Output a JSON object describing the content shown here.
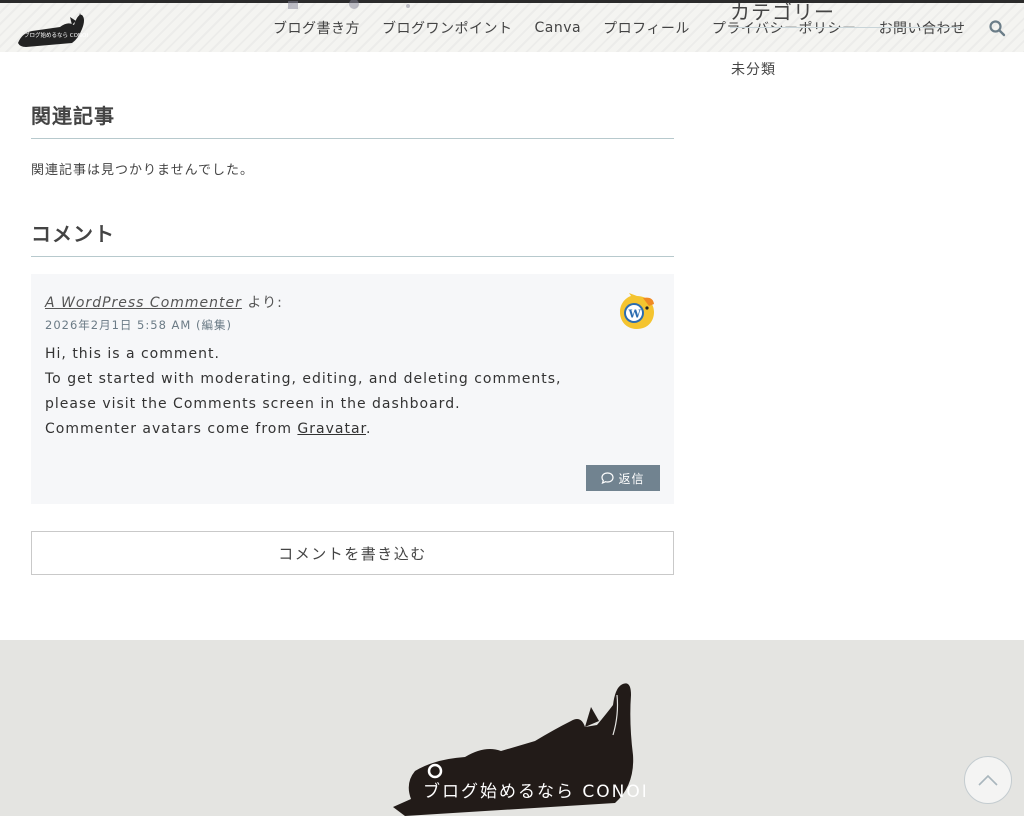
{
  "header": {
    "logo_text": "ブログ始めるなら CONOHA WING !!",
    "nav": [
      "ブログ書き方",
      "ブログワンポイント",
      "Canva",
      "プロフィール",
      "プライバシーポリシー",
      "お問い合わせ"
    ]
  },
  "sidebar": {
    "heading": "カテゴリー",
    "category": "未分類"
  },
  "related": {
    "title": "関連記事",
    "empty_message": "関連記事は見つかりませんでした。"
  },
  "comments": {
    "title": "コメント",
    "items": [
      {
        "author": "A WordPress Commenter",
        "author_suffix": "より:",
        "date": "2026年2月1日 5:58 AM",
        "edit": "(編集)",
        "lines": [
          "Hi, this is a comment.",
          "To get started with moderating, editing, and deleting comments,",
          "please visit the Comments screen in the dashboard."
        ],
        "last_line_prefix": "Commenter avatars come from ",
        "last_line_link": "Gravatar",
        "last_line_suffix": ".",
        "reply_label": "返信"
      }
    ],
    "write_button": "コメントを書き込む"
  },
  "footer": {
    "logo_text": "ブログ始めるなら CONOHA WING !!"
  },
  "colors": {
    "reply_button": "#718390",
    "footer_bg": "#e4e4e1",
    "underline": "#b7c9cd"
  }
}
